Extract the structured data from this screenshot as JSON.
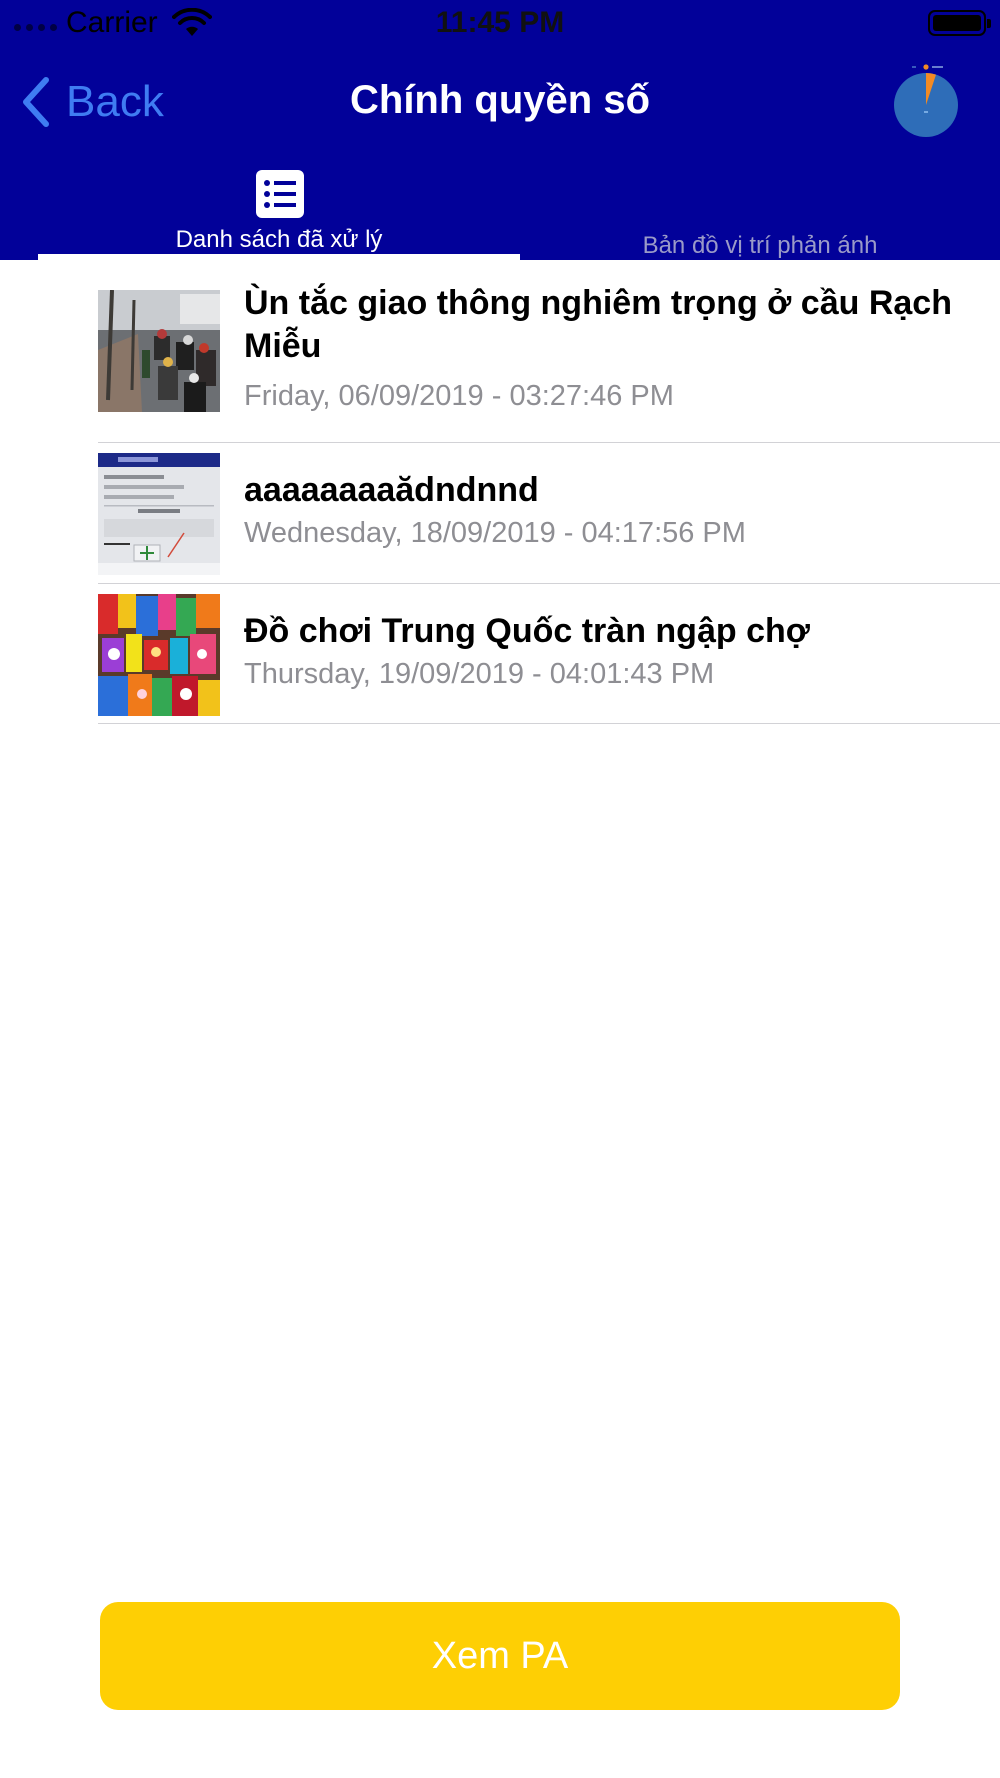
{
  "status_bar": {
    "carrier": "Carrier",
    "time": "11:45 PM"
  },
  "nav": {
    "back_label": "Back",
    "title": "Chính quyền số",
    "accent_color": "#3f7cf2",
    "background_color": "#020199"
  },
  "tabs": [
    {
      "label": "Danh sách đã xử lý",
      "icon": "list-icon",
      "selected": true
    },
    {
      "label": "Bản đồ vị trí phản ánh",
      "icon": "",
      "selected": false
    }
  ],
  "items": [
    {
      "title": "Ùn tắc giao thông nghiêm trọng ở cầu Rạch Miễu",
      "date": "Friday, 06/09/2019 - 03:27:46 PM",
      "thumbnail": "traffic-photo"
    },
    {
      "title": "aaaaaaaaădndnnd",
      "date": "Wednesday, 18/09/2019 - 04:17:56 PM",
      "thumbnail": "app-screenshot"
    },
    {
      "title": "Đồ chơi Trung Quốc tràn ngập chợ",
      "date": "Thursday, 19/09/2019 - 04:01:43 PM",
      "thumbnail": "toys-market-photo"
    }
  ],
  "footer": {
    "button_label": "Xem PA",
    "button_color": "#fecf04"
  }
}
